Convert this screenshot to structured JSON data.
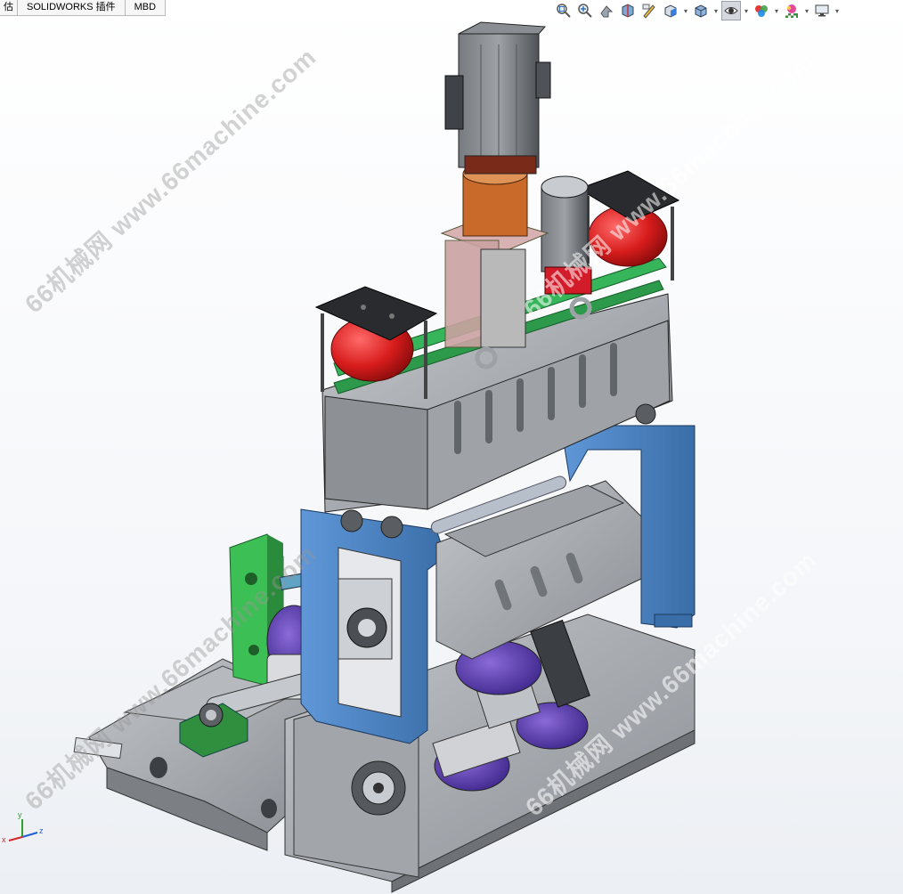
{
  "tabs": [
    "估",
    "SOLIDWORKS 插件",
    "MBD"
  ],
  "watermark": "66机械网 www.66machine.com",
  "hud_icons": [
    {
      "name": "zoom-to-fit-icon"
    },
    {
      "name": "zoom-to-area-icon"
    },
    {
      "name": "previous-view-icon"
    },
    {
      "name": "section-view-icon"
    },
    {
      "name": "dynamic-annotation-icon"
    },
    {
      "name": "view-orientation-icon",
      "dropdown": true
    },
    {
      "name": "display-style-icon",
      "dropdown": true
    },
    {
      "name": "hide-show-items-icon",
      "dropdown": true,
      "active": true
    },
    {
      "name": "edit-appearance-icon",
      "dropdown": true
    },
    {
      "name": "apply-scene-icon",
      "dropdown": true
    },
    {
      "name": "view-settings-icon",
      "dropdown": true
    }
  ],
  "colors": {
    "frame_gray": "#a7abb0",
    "frame_blue": "#4a82c4",
    "bracket_green": "#3cbf54",
    "ball_red": "#d81c1c",
    "motor_dark": "#5c5f63",
    "coupling_orange": "#c96a2a",
    "mount_pink": "#d8b2b2",
    "wheel_purple": "#5e40b0",
    "rail_green": "#37b55a"
  },
  "triad": {
    "x": "x",
    "y": "y",
    "z": "z"
  }
}
